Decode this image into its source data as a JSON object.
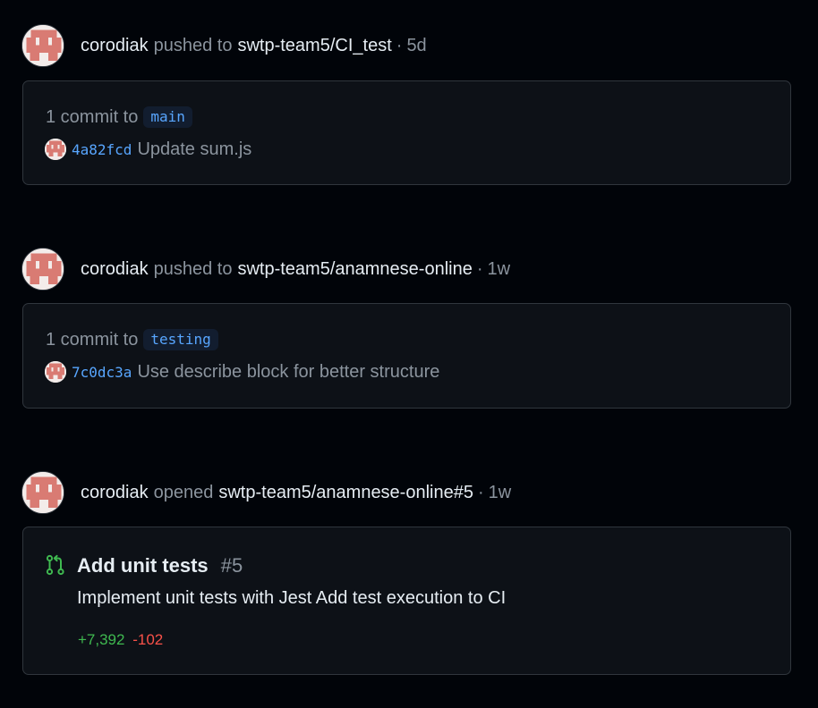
{
  "colors": {
    "background": "#010409",
    "card_background": "#0d1117",
    "border": "#30363d",
    "link_blue": "#58a6ff",
    "additions_green": "#3fb950",
    "deletions_red": "#f85149",
    "avatar_pink": "#d97b73"
  },
  "events": [
    {
      "actor": "corodiak",
      "action": "pushed to",
      "target": "swtp-team5/CI_test",
      "separator": "·",
      "time": "5d",
      "commit_count_label": "1 commit to",
      "branch": "main",
      "commits": [
        {
          "sha": "4a82fcd",
          "message": "Update sum.js"
        }
      ]
    },
    {
      "actor": "corodiak",
      "action": "pushed to",
      "target": "swtp-team5/anamnese-online",
      "separator": "·",
      "time": "1w",
      "commit_count_label": "1 commit to",
      "branch": "testing",
      "commits": [
        {
          "sha": "7c0dc3a",
          "message": "Use describe block for better structure"
        }
      ]
    },
    {
      "actor": "corodiak",
      "action": "opened",
      "target": "swtp-team5/anamnese-online#5",
      "separator": "·",
      "time": "1w",
      "pull_request": {
        "icon": "git-pull-request-icon",
        "title": "Add unit tests",
        "number": "#5",
        "body": "Implement unit tests with Jest Add test execution to CI",
        "additions": "+7,392",
        "deletions": "-102"
      }
    }
  ]
}
